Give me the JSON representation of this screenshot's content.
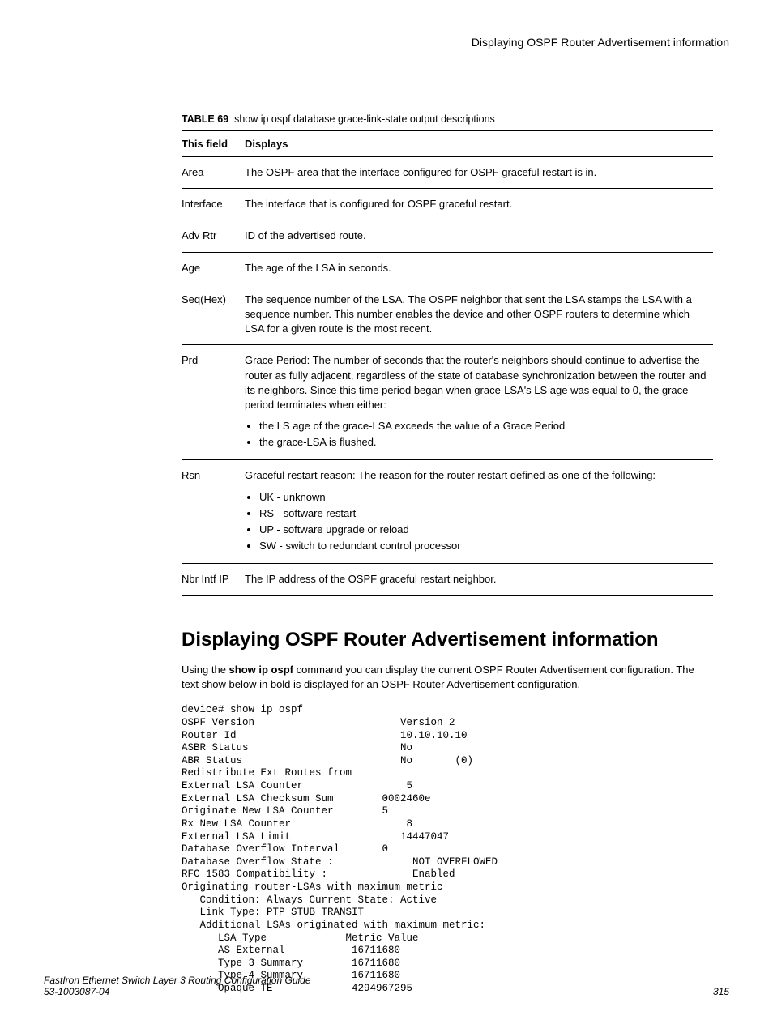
{
  "header": {
    "running_title": "Displaying OSPF Router Advertisement information"
  },
  "table": {
    "label": "TABLE 69",
    "caption": "show ip ospf database grace-link-state output descriptions",
    "head_field": "This field",
    "head_disp": "Displays",
    "rows": {
      "area": {
        "f": "Area",
        "d": "The OSPF area that the interface configured for OSPF graceful restart is in."
      },
      "interface": {
        "f": "Interface",
        "d": "The interface that is configured for OSPF graceful restart."
      },
      "advrtr": {
        "f": "Adv Rtr",
        "d": "ID of the advertised route."
      },
      "age": {
        "f": "Age",
        "d": "The age of the LSA in seconds."
      },
      "seqhex": {
        "f": "Seq(Hex)",
        "d": "The sequence number of the LSA. The OSPF neighbor that sent the LSA stamps the LSA with a sequence number. This number enables the device and other OSPF routers to determine which LSA for a given route is the most recent."
      },
      "prd": {
        "f": "Prd",
        "d_lead": "Grace Period: The number of seconds that the router's neighbors should continue to advertise the router as fully adjacent, regardless of the state of database synchronization between the router and its neighbors. Since this time period began when grace-LSA's LS age was equal to 0, the grace period terminates when either:",
        "b1": "the LS age of the grace-LSA exceeds the value of a Grace Period",
        "b2": "the grace-LSA is flushed."
      },
      "rsn": {
        "f": "Rsn",
        "d_lead": "Graceful restart reason: The reason for the router restart defined as one of the following:",
        "b1": "UK - unknown",
        "b2": "RS - software restart",
        "b3": "UP - software upgrade or reload",
        "b4": "SW - switch to redundant control processor"
      },
      "nbr": {
        "f": "Nbr Intf IP",
        "d": "The IP address of the OSPF graceful restart neighbor."
      }
    }
  },
  "section": {
    "title": "Displaying OSPF Router Advertisement information",
    "para_pre": "Using the ",
    "para_cmd": "show ip ospf",
    "para_post": " command you can display the current OSPF Router Advertisement configuration. The text show below in bold is displayed for an OSPF Router Advertisement configuration.",
    "cli": "device# show ip ospf\nOSPF Version                        Version 2\nRouter Id                           10.10.10.10\nASBR Status                         No\nABR Status                          No       (0)\nRedistribute Ext Routes from\nExternal LSA Counter                 5\nExternal LSA Checksum Sum        0002460e\nOriginate New LSA Counter        5\nRx New LSA Counter                   8\nExternal LSA Limit                  14447047\nDatabase Overflow Interval       0\nDatabase Overflow State :             NOT OVERFLOWED\nRFC 1583 Compatibility :              Enabled\nOriginating router-LSAs with maximum metric\n   Condition: Always Current State: Active\n   Link Type: PTP STUB TRANSIT\n   Additional LSAs originated with maximum metric:\n      LSA Type             Metric Value\n      AS-External           16711680\n      Type 3 Summary        16711680\n      Type 4 Summary        16711680\n      Opaque-TE             4294967295"
  },
  "footer": {
    "book": "FastIron Ethernet Switch Layer 3 Routing Configuration Guide",
    "docnum": "53-1003087-04",
    "page": "315"
  }
}
